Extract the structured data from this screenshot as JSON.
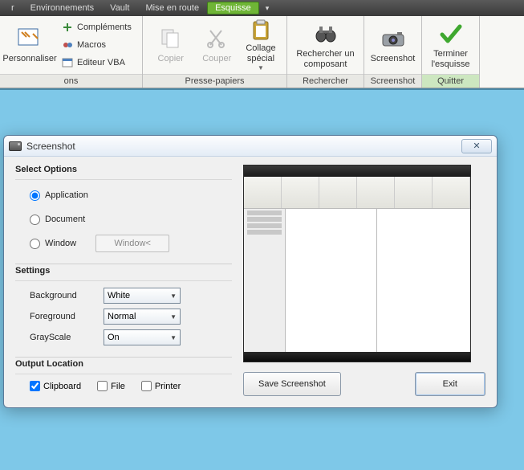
{
  "menubar": {
    "items": [
      "r",
      "Environnements",
      "Vault",
      "Mise en route",
      "Esquisse"
    ],
    "active_index": 4
  },
  "ribbon": {
    "personalize": {
      "big": "Personnaliser",
      "complements": "Compléments",
      "macros": "Macros",
      "editor": "Editeur VBA",
      "panel_label": "ons"
    },
    "clipboard": {
      "copy": "Copier",
      "cut": "Couper",
      "paste": "Collage spécial",
      "panel_label": "Presse-papiers"
    },
    "search": {
      "label": "Rechercher un composant",
      "panel_label": "Rechercher"
    },
    "screenshot": {
      "label": "Screenshot",
      "panel_label": "Screenshot"
    },
    "quit": {
      "label": "Terminer l'esquisse",
      "panel_label": "Quitter"
    }
  },
  "dialog": {
    "title": "Screenshot",
    "select_options": {
      "title": "Select Options",
      "application": "Application",
      "document": "Document",
      "window": "Window",
      "window_btn": "Window<"
    },
    "settings": {
      "title": "Settings",
      "background_label": "Background",
      "background_value": "White",
      "foreground_label": "Foreground",
      "foreground_value": "Normal",
      "grayscale_label": "GrayScale",
      "grayscale_value": "On"
    },
    "output": {
      "title": "Output Location",
      "clipboard": "Clipboard",
      "file": "File",
      "printer": "Printer"
    },
    "buttons": {
      "save": "Save Screenshot",
      "exit": "Exit"
    }
  }
}
